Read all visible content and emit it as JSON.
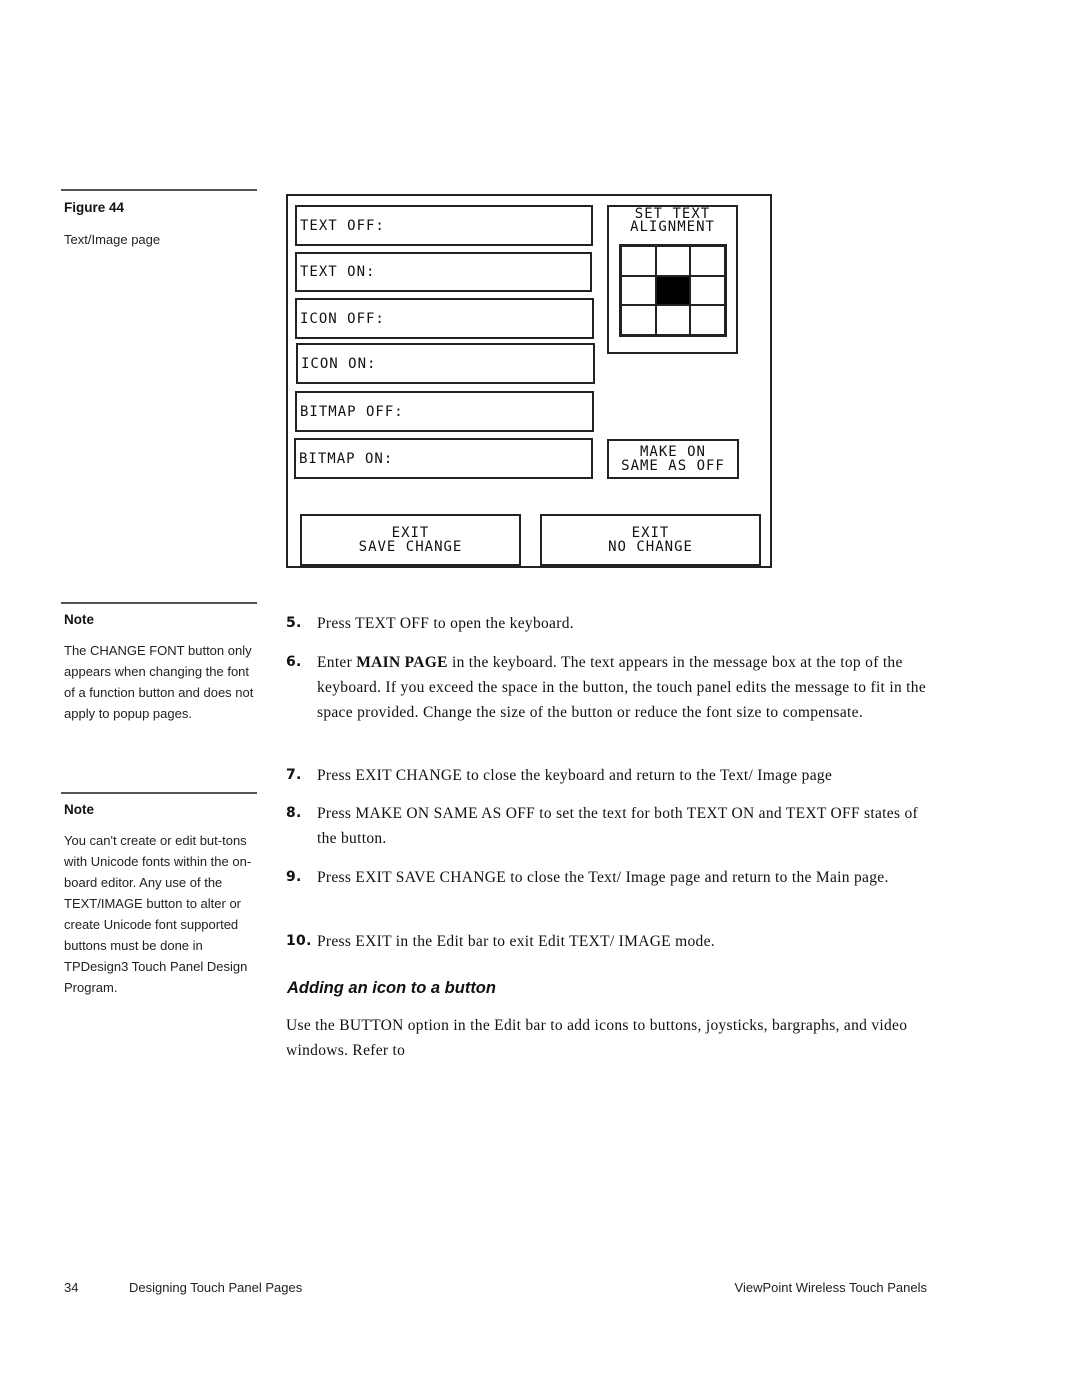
{
  "sidebar": {
    "figure": {
      "label": "Figure 44",
      "caption": "Text/Image page"
    },
    "notes": [
      {
        "heading": "Note",
        "body": "The CHANGE FONT button only appears when changing the font of a function button and does not apply to popup pages."
      },
      {
        "heading": "Note",
        "body": "You can't create or edit but-tons with Unicode fonts within the on-board editor. Any use of the TEXT/IMAGE button to alter or create Unicode font supported buttons must be done in TPDesign3 Touch Panel Design Program."
      }
    ]
  },
  "figure_panel": {
    "fields": [
      {
        "label": "TEXT OFF:"
      },
      {
        "label": "TEXT ON:"
      },
      {
        "label": "ICON OFF:"
      },
      {
        "label": "ICON ON:"
      },
      {
        "label": "BITMAP OFF:"
      },
      {
        "label": "BITMAP ON:"
      }
    ],
    "alignment": {
      "title_line1": "SET TEXT",
      "title_line2": "ALIGNMENT",
      "selected": "middle-center"
    },
    "make_on_same": {
      "line1": "MAKE ON",
      "line2": "SAME AS OFF"
    },
    "exit_save": {
      "line1": "EXIT",
      "line2": "SAVE CHANGE"
    },
    "exit_no": {
      "line1": "EXIT",
      "line2": "NO CHANGE"
    }
  },
  "steps": [
    {
      "num": "5.",
      "pre": "Press TEXT OFF to open the keyboard.",
      "bold": "",
      "post": ""
    },
    {
      "num": "6.",
      "pre": "Enter ",
      "bold": "MAIN PAGE",
      "post": " in the keyboard. The text appears in the message box at the top of the keyboard. If you exceed the space in the button, the touch panel edits the message to fit in the space provided. Change the size of the button or reduce the font size to compensate."
    },
    {
      "num": "7.",
      "pre": "Press EXIT CHANGE to close the keyboard and return to the Text/ Image page",
      "bold": "",
      "post": ""
    },
    {
      "num": "8.",
      "pre": "Press MAKE ON SAME AS OFF to set the text for both TEXT ON and TEXT OFF states of the button.",
      "bold": "",
      "post": ""
    },
    {
      "num": "9.",
      "pre": "Press EXIT SAVE CHANGE to close the Text/ Image page and return to the Main page.",
      "bold": "",
      "post": ""
    },
    {
      "num": "10.",
      "pre": "Press EXIT in the Edit bar to exit Edit TEXT/ IMAGE mode.",
      "bold": "",
      "post": ""
    }
  ],
  "section": {
    "heading": "Adding an icon to a button",
    "paragraph": "Use the BUTTON option in the Edit bar to add icons to buttons, joysticks, bargraphs, and video windows. Refer to"
  },
  "footer": {
    "page_number": "34",
    "chapter": "Designing Touch Panel Pages",
    "book_title": "ViewPoint Wireless Touch Panels"
  }
}
